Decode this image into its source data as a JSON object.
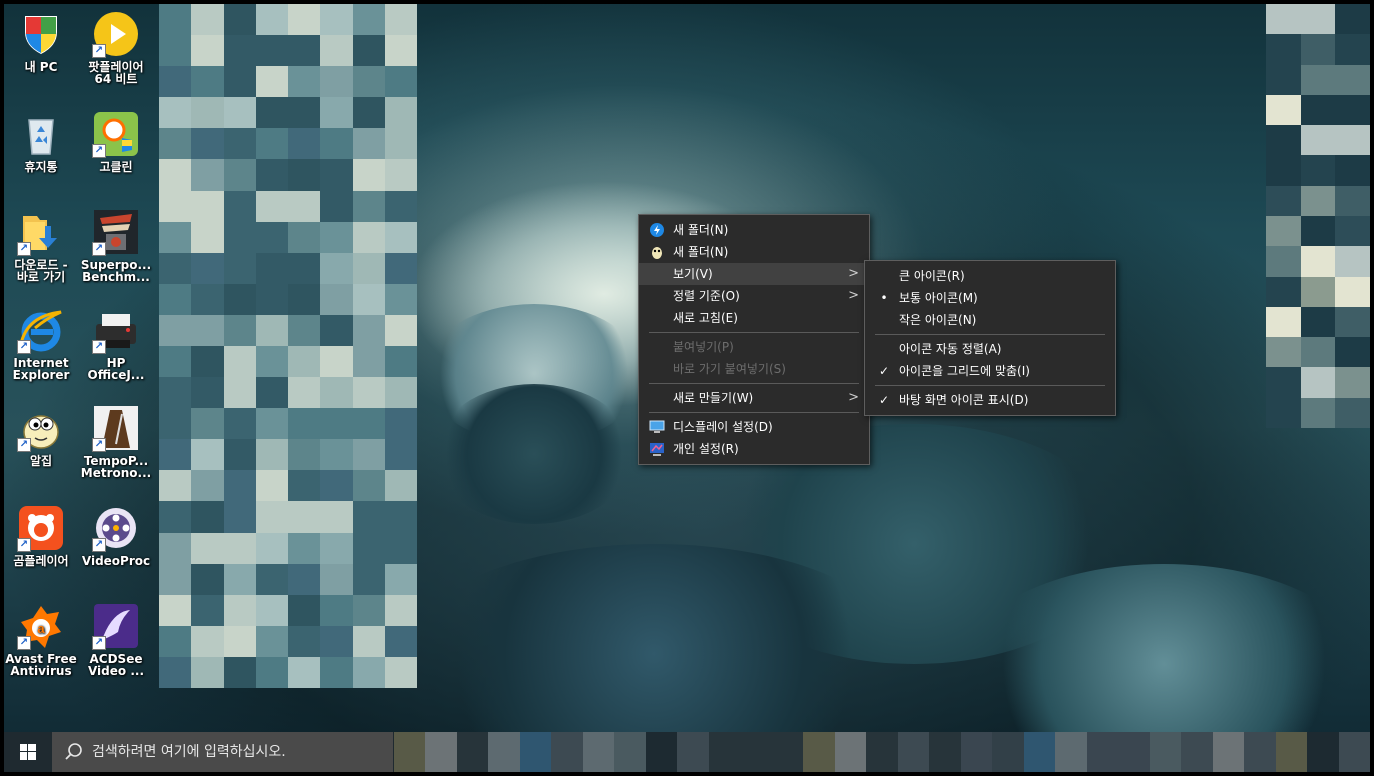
{
  "desktop": {
    "icons": [
      {
        "label": "내 PC",
        "icon": "this-pc-icon"
      },
      {
        "label": "팟플레이어\n64 비트",
        "icon": "potplayer-icon"
      },
      {
        "label": "휴지통",
        "icon": "recycle-bin-icon"
      },
      {
        "label": "고클린",
        "icon": "goclean-icon"
      },
      {
        "label": "다운로드 -\n바로 가기",
        "icon": "downloads-folder-icon"
      },
      {
        "label": "Superpo...\nBenchm...",
        "icon": "superposition-icon"
      },
      {
        "label": "Internet\nExplorer",
        "icon": "internet-explorer-icon"
      },
      {
        "label": "HP\nOfficeJ...",
        "icon": "hp-printer-icon"
      },
      {
        "label": "알집",
        "icon": "alzip-icon"
      },
      {
        "label": "TempoP...\nMetrono...",
        "icon": "metronome-icon"
      },
      {
        "label": "곰플레이어",
        "icon": "gomplayer-icon"
      },
      {
        "label": "VideoProc",
        "icon": "videoproc-icon"
      },
      {
        "label": "Avast Free\nAntivirus",
        "icon": "avast-icon"
      },
      {
        "label": "ACDSee\nVideo ...",
        "icon": "acdsee-icon"
      }
    ]
  },
  "context_menu": {
    "items": [
      {
        "label": "새 폴더(N)",
        "icon": "new-folder-icon"
      },
      {
        "label": "새 폴더(N)",
        "icon": "new-folder-alt-icon"
      },
      {
        "label": "보기(V)",
        "submenu": true
      },
      {
        "label": "정렬 기준(O)",
        "submenu": true
      },
      {
        "label": "새로 고침(E)"
      },
      {
        "label": "붙여넣기(P)",
        "disabled": true
      },
      {
        "label": "바로 가기 붙여넣기(S)",
        "disabled": true
      },
      {
        "label": "새로 만들기(W)",
        "submenu": true
      },
      {
        "label": "디스플레이 설정(D)",
        "icon": "display-settings-icon"
      },
      {
        "label": "개인 설정(R)",
        "icon": "personalize-icon"
      }
    ]
  },
  "view_submenu": {
    "items": [
      {
        "label": "큰 아이콘(R)"
      },
      {
        "label": "보통 아이콘(M)",
        "mark": "•"
      },
      {
        "label": "작은 아이콘(N)"
      },
      {
        "label": "아이콘 자동 정렬(A)"
      },
      {
        "label": "아이콘을 그리드에 맞춤(I)",
        "mark": "✓"
      },
      {
        "label": "바탕 화면 아이콘 표시(D)",
        "mark": "✓"
      }
    ]
  },
  "taskbar": {
    "start_icon": "windows-logo-icon",
    "search_placeholder": "검색하려면 여기에 입력하십시오.",
    "search_icon": "search-icon"
  },
  "colors": {
    "menu_bg": "#2b2b2b",
    "menu_highlight": "#414141",
    "taskbar_bg": "#1f2a30",
    "search_bg": "#4a4a4a"
  }
}
